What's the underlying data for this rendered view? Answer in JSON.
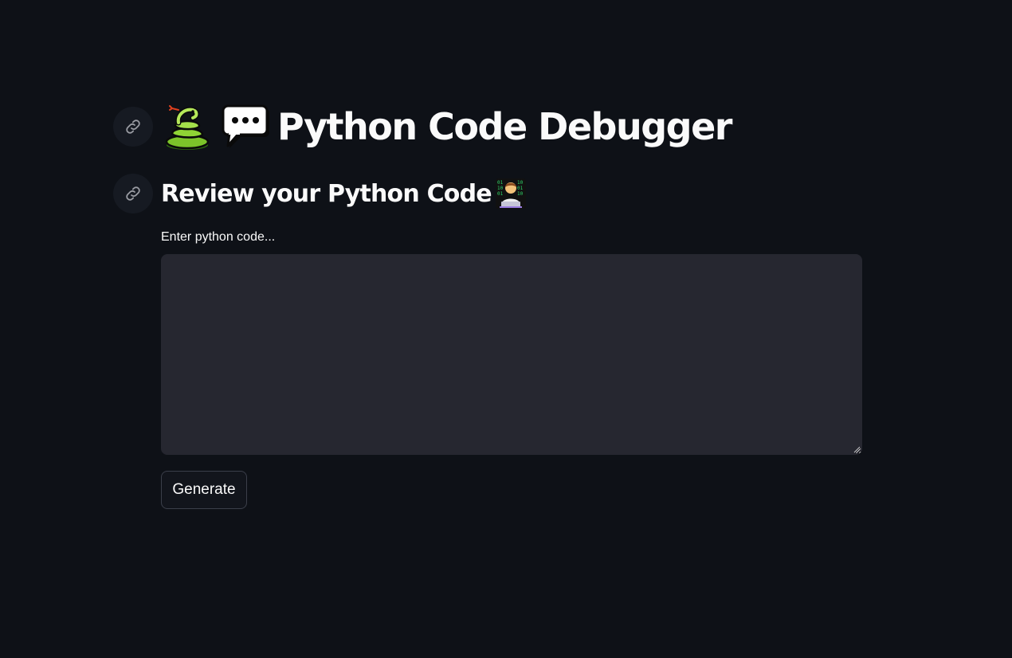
{
  "header": {
    "title": "Python Code Debugger",
    "title_icons": [
      "snake-icon",
      "speech-bubble-icon"
    ]
  },
  "section": {
    "subtitle": "Review your Python Code",
    "subtitle_icon": "technologist-icon"
  },
  "code_input": {
    "label": "Enter python code...",
    "value": "",
    "placeholder": ""
  },
  "actions": {
    "generate_label": "Generate"
  },
  "colors": {
    "background": "#0e1117",
    "text": "#fafafa",
    "input_background": "#262730",
    "button_border": "#3b3f4a"
  }
}
